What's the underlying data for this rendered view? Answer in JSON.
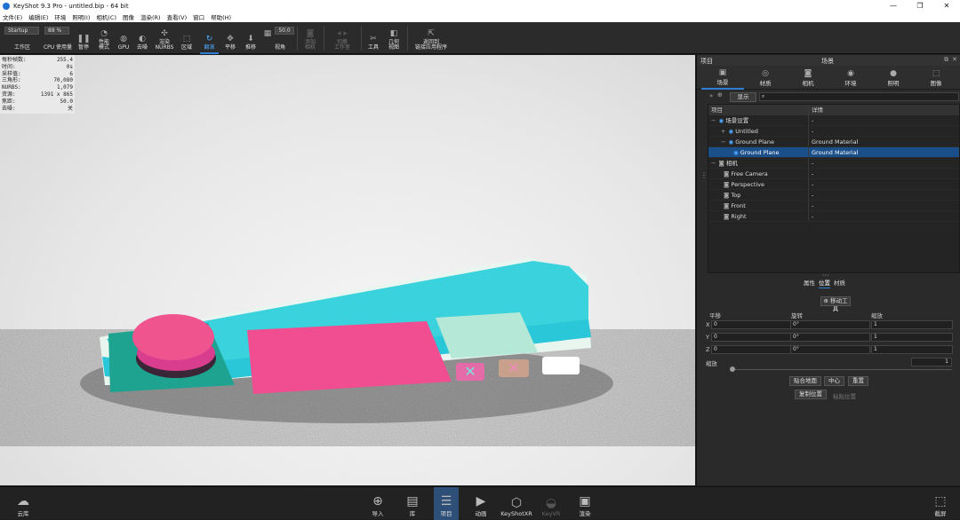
{
  "window": {
    "title": "KeyShot 9.3 Pro  - untitled.bip  - 64 bit",
    "controls": [
      "—",
      "❐",
      "✕"
    ]
  },
  "menu": [
    "文件(E)",
    "编辑(E)",
    "环境",
    "照明(I)",
    "相机(C)",
    "图像",
    "渲染(R)",
    "查看(V)",
    "窗口",
    "帮助(H)"
  ],
  "toolbar": {
    "workspace_select": "Startup",
    "cpu_select": "88 %",
    "workspace_label": "工作区",
    "cpu_label": "CPU 使用量",
    "pause": "暂停",
    "perf_mode": [
      "性能",
      "模式"
    ],
    "gpu": "GPU",
    "denoise": "去噪",
    "render_nurbs": [
      "渲染",
      "NURBS"
    ],
    "region": "区域",
    "tumble": "翻滚",
    "pan": "平移",
    "dolly": "推移",
    "fov_value": "50.0",
    "fov_label": "视角",
    "add_camera": [
      "添加",
      "相机"
    ],
    "switch_studio": [
      "切换",
      "工作室"
    ],
    "tools": "工具",
    "geometry_view": [
      "几何",
      "视图"
    ],
    "link_app": [
      "返回到",
      "链接应用程序"
    ]
  },
  "stats": [
    {
      "k": "每秒帧数:",
      "v": "255.4"
    },
    {
      "k": "时间:",
      "v": "0s"
    },
    {
      "k": "采样值:",
      "v": "6"
    },
    {
      "k": "三角形:",
      "v": "70,080"
    },
    {
      "k": "NURBS:",
      "v": "1,079"
    },
    {
      "k": "资源:",
      "v": "1391 x 865"
    },
    {
      "k": "焦距:",
      "v": "50.0"
    },
    {
      "k": "去噪:",
      "v": "关"
    }
  ],
  "panel": {
    "header_left": "项目",
    "header_center": "场景",
    "tabs": [
      "场景",
      "材质",
      "相机",
      "环境",
      "照明",
      "图像"
    ],
    "filter_btn": "显示",
    "columns": [
      "项目",
      "详情"
    ],
    "tree": [
      {
        "indent": 0,
        "name": "场景设置",
        "detail": "-"
      },
      {
        "indent": 1,
        "name": "Untitled",
        "detail": "-"
      },
      {
        "indent": 1,
        "name": "Ground Plane",
        "detail": "Ground Material"
      },
      {
        "indent": 2,
        "name": "Ground Plane",
        "detail": "Ground Material",
        "selected": true
      },
      {
        "indent": 0,
        "name": "相机",
        "detail": "-"
      },
      {
        "indent": 1,
        "name": "Free Camera",
        "detail": "-"
      },
      {
        "indent": 1,
        "name": "Perspective",
        "detail": "-"
      },
      {
        "indent": 1,
        "name": "Top",
        "detail": "-"
      },
      {
        "indent": 1,
        "name": "Front",
        "detail": "-"
      },
      {
        "indent": 1,
        "name": "Right",
        "detail": "-"
      }
    ],
    "subtabs": [
      "属性",
      "位置",
      "材质"
    ],
    "move_tool": "移动工具",
    "translate": "平移",
    "rotate": "旋转",
    "scale": "缩放",
    "axes": [
      "X",
      "Y",
      "Z"
    ],
    "translate_vals": [
      "0",
      "0",
      "0"
    ],
    "rotate_vals": [
      "0°",
      "0°",
      "0°"
    ],
    "scale_vals": [
      "1",
      "1",
      "1"
    ],
    "uniform_scale_label": "缩放",
    "uniform_scale_val": "1",
    "snap_ground": "贴合地面",
    "center": "中心",
    "reset": "重置",
    "copy_pos": "复制位置",
    "paste_pos": "粘贴位置"
  },
  "statusbar": {
    "cloud": "云库",
    "import": "导入",
    "library": "库",
    "project": "项目",
    "animation": "动画",
    "keyshotxr": "KeyShotXR",
    "render_disabled": "KeyVR",
    "render": "渲染",
    "screenshot": "截屏"
  }
}
